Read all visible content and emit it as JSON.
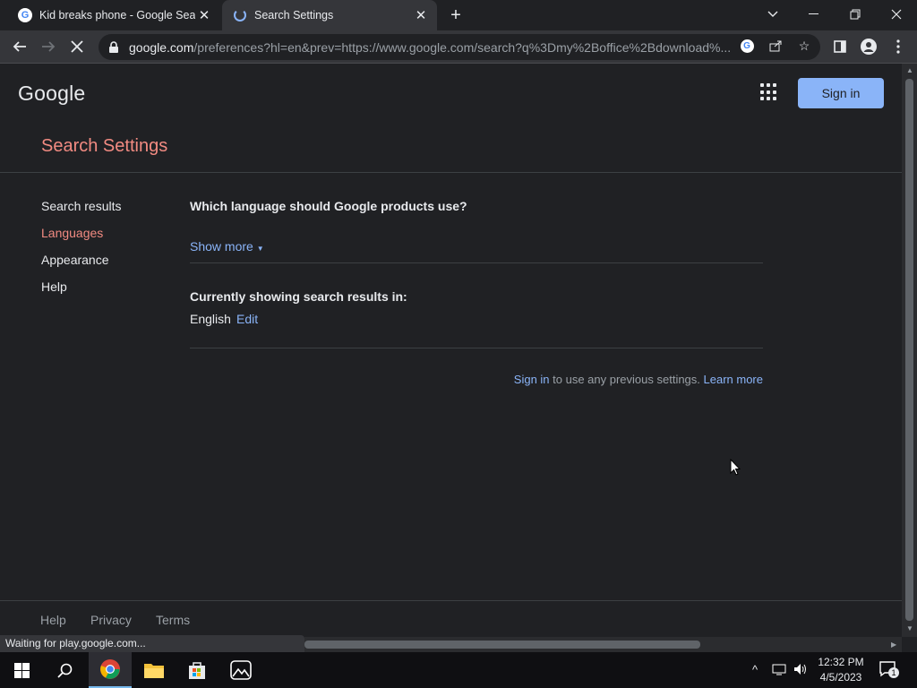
{
  "tabs": [
    {
      "title": "Kid breaks phone - Google Searc",
      "favicon": "google-g-icon",
      "active": false
    },
    {
      "title": "Search Settings",
      "favicon": "loading-spinner-icon",
      "active": true
    }
  ],
  "window_controls": [
    "tab-search-icon",
    "minimize-icon",
    "restore-icon",
    "close-icon"
  ],
  "address_bar": {
    "url_host": "google.com",
    "url_rest": "/preferences?hl=en&prev=https://www.google.com/search?q%3Dmy%2Boffice%2Bdownload%..."
  },
  "header": {
    "logo": "Google",
    "sign_in_label": "Sign in"
  },
  "page_title": "Search Settings",
  "sidebar": {
    "items": [
      {
        "label": "Search results",
        "active": false
      },
      {
        "label": "Languages",
        "active": true
      },
      {
        "label": "Appearance",
        "active": false
      },
      {
        "label": "Help",
        "active": false
      }
    ]
  },
  "main": {
    "language_question": "Which language should Google products use?",
    "show_more": "Show more",
    "results_heading": "Currently showing search results in:",
    "results_language": "English",
    "edit_label": "Edit",
    "signin_link": "Sign in",
    "signin_note": " to use any previous settings. ",
    "learn_more": "Learn more"
  },
  "footer": {
    "links": [
      "Help",
      "Privacy",
      "Terms"
    ]
  },
  "status_bar": "Waiting for play.google.com...",
  "taskbar": {
    "time": "12:32 PM",
    "date": "4/5/2023",
    "notification_count": "1"
  },
  "colors": {
    "accent_link": "#8ab4f8",
    "active_red": "#f28b82",
    "background": "#202124"
  }
}
